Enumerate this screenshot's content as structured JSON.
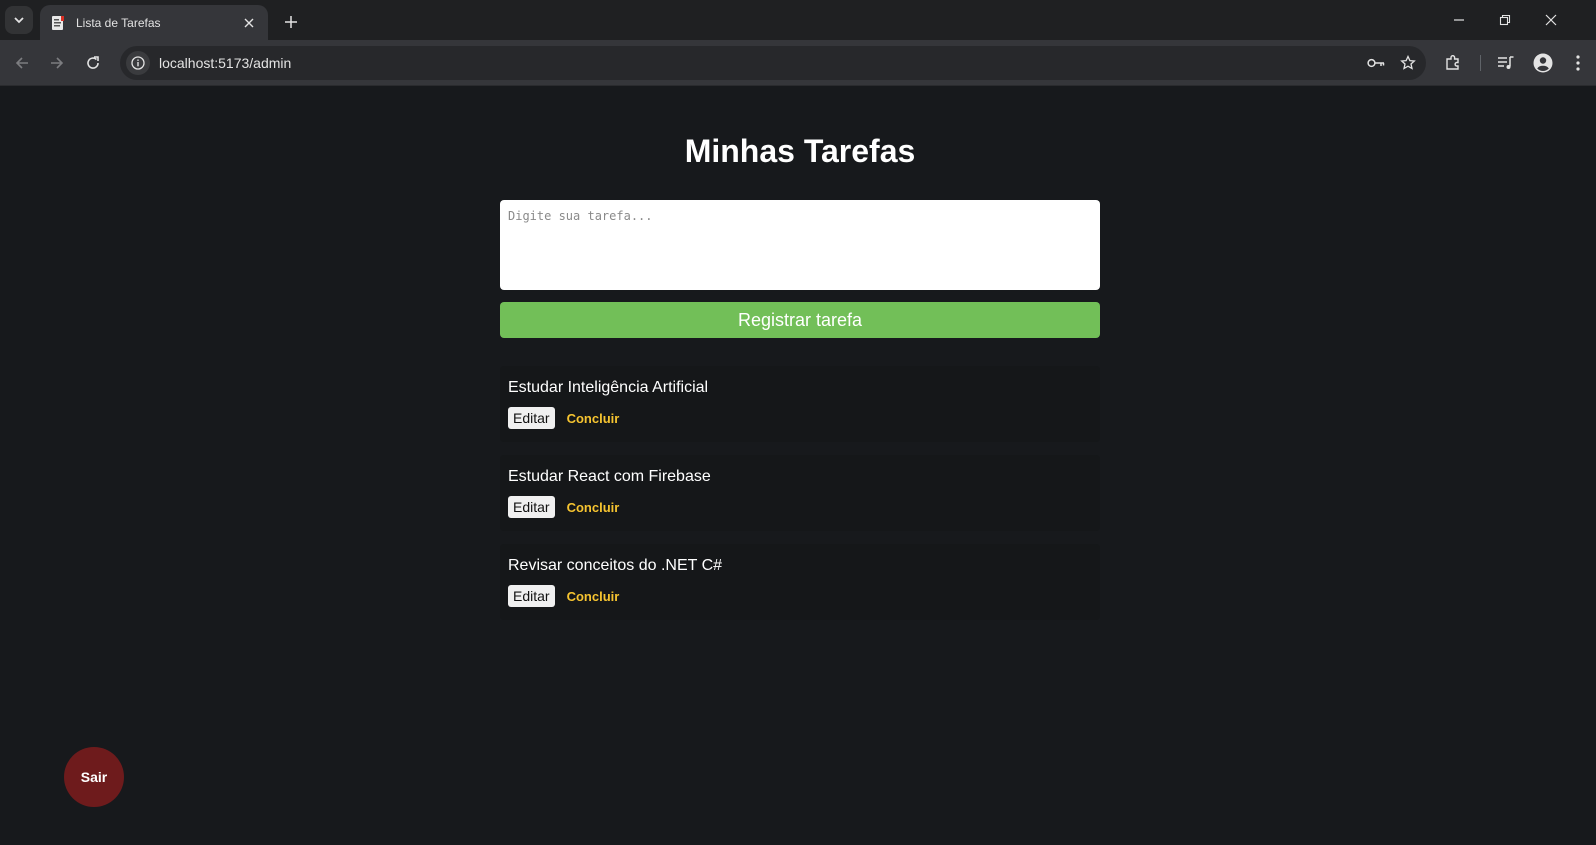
{
  "browser": {
    "tab_title": "Lista de Tarefas",
    "url": "localhost:5173/admin",
    "theme": {
      "frame": "#1f2022",
      "toolbar": "#35363a",
      "omnibox": "#27282b"
    }
  },
  "page": {
    "title": "Minhas Tarefas",
    "input_placeholder": "Digite sua tarefa...",
    "input_value": "",
    "register_label": "Registrar tarefa",
    "logout_label": "Sair",
    "colors": {
      "background": "#17191c",
      "register": "#72bf58",
      "conclude": "#f6c430",
      "logout": "#6e1b1c"
    }
  },
  "tasks": [
    {
      "text": "Estudar Inteligência Artificial",
      "edit_label": "Editar",
      "done_label": "Concluir"
    },
    {
      "text": "Estudar React com Firebase",
      "edit_label": "Editar",
      "done_label": "Concluir"
    },
    {
      "text": "Revisar conceitos do .NET C#",
      "edit_label": "Editar",
      "done_label": "Concluir"
    }
  ]
}
